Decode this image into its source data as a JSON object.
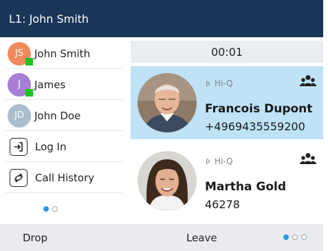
{
  "header": {
    "line_label": "L1: John Smith"
  },
  "sidebar": {
    "contacts": [
      {
        "initials": "JS",
        "name": "John Smith",
        "color": "#f08a5d",
        "presence": "available"
      },
      {
        "initials": "J",
        "name": "James",
        "color": "#a77fd4",
        "presence": "available"
      },
      {
        "initials": "JD",
        "name": "John Doe",
        "color": "#a9bdcc",
        "presence": "none"
      }
    ],
    "actions": [
      {
        "label": "Log In",
        "icon": "login-icon"
      },
      {
        "label": "Call History",
        "icon": "call-history-icon"
      }
    ],
    "pager": {
      "current": 1,
      "total": 2
    }
  },
  "call_panel": {
    "timer": "00:01",
    "calls": [
      {
        "codec": "Hi-Q",
        "name": "Francois Dupont",
        "number": "+4969435559200",
        "active": true,
        "icon": "conference-icon"
      },
      {
        "codec": "Hi-Q",
        "name": "Martha Gold",
        "number": "46278",
        "active": false,
        "icon": "conference-icon"
      }
    ]
  },
  "softkeys": {
    "left": "Drop",
    "center": "Leave",
    "pager": {
      "current": 1,
      "total": 3
    }
  },
  "colors": {
    "header": "#1c3659",
    "accent": "#2a9ae8",
    "active_call": "#bfe2f5",
    "presence": "#1cc61c"
  }
}
